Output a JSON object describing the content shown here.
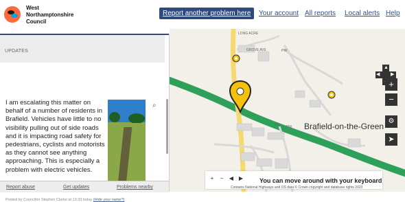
{
  "header": {
    "logo_lines": [
      "West",
      "Northamptonshire",
      "Council"
    ]
  },
  "nav": {
    "report_another": "Report another problem here",
    "your_account": "Your account",
    "all_reports": "All reports",
    "local_alerts": "Local alerts",
    "help": "Help"
  },
  "sidebar": {
    "section_title": "UPDATES",
    "update_text": "I am escalating this matter on behalf of a number of residents in Brafield. Vehicles have little to no visibility pulling out of side roads and it is impacting road safety for pedestrians, cyclists and motorists as they cannot see anything approaching. This is especially a problem with electric vehicles.",
    "posted_by": "Posted by Councillor Stephen Clarke at 13:33 today",
    "hide_name": "(Hide your name?)",
    "zoom_icon": "magnifier-icon"
  },
  "footer": {
    "report_abuse": "Report abuse",
    "get_updates": "Get updates",
    "problems_nearby": "Problems nearby"
  },
  "map": {
    "main_label": "Brafield-on-the-Green",
    "labels": {
      "long_acre": "LONG ACRE",
      "grove_avenue": "GROVE AVE",
      "pw_top": "PW",
      "pw_mid": "PW",
      "po": "PO"
    },
    "controls": {
      "zoom_in": "+",
      "zoom_out": "−",
      "pan_icon": "pan-arrows-icon",
      "layers_icon": "layers-icon",
      "locate_icon": "locate-icon"
    },
    "keyboard_hint": "You can move around with your keyboard",
    "attribution": "Contains National Highways and OS data © Crown copyright and database rights 2023"
  },
  "colors": {
    "brand_blue": "#2f4a7e",
    "road_green": "#2ea05a",
    "pin_yellow": "#f4c20d"
  }
}
